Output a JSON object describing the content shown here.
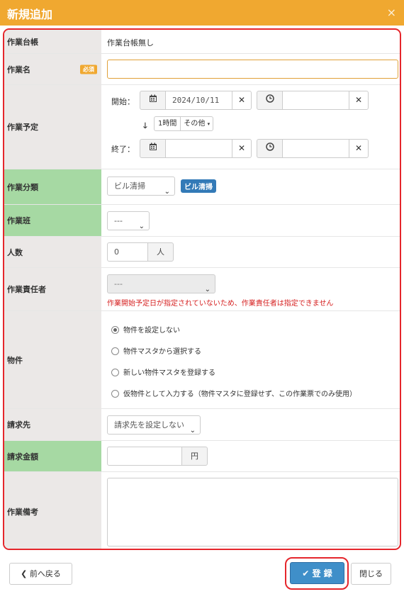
{
  "header": {
    "title": "新規追加",
    "close": "×"
  },
  "fields": {
    "ledger": {
      "label": "作業台帳",
      "value": "作業台帳無し"
    },
    "name": {
      "label": "作業名",
      "required": "必須",
      "value": ""
    },
    "schedule": {
      "label": "作業予定",
      "start_label": "開始：",
      "start_date": "2024/10/11",
      "start_time": "",
      "duration": "1時間",
      "other": "その他",
      "end_label": "終了：",
      "end_date": "",
      "end_time": ""
    },
    "category": {
      "label": "作業分類",
      "selected": "ビル清掃",
      "badge": "ビル清掃"
    },
    "team": {
      "label": "作業班",
      "selected": "---"
    },
    "people": {
      "label": "人数",
      "value": "0",
      "unit": "人"
    },
    "manager": {
      "label": "作業責任者",
      "selected": "---",
      "error": "作業開始予定日が指定されていないため、作業責任者は指定できません"
    },
    "property": {
      "label": "物件",
      "options": [
        {
          "label": "物件を設定しない",
          "checked": true
        },
        {
          "label": "物件マスタから選択する",
          "checked": false
        },
        {
          "label": "新しい物件マスタを登録する",
          "checked": false
        },
        {
          "label": "仮物件として入力する（物件マスタに登録せず、この作業票でのみ使用）",
          "checked": false
        }
      ]
    },
    "billing": {
      "label": "請求先",
      "selected": "請求先を設定しない"
    },
    "amount": {
      "label": "請求金額",
      "value": "",
      "unit": "円"
    },
    "notes": {
      "label": "作業備考",
      "value": ""
    }
  },
  "footer": {
    "back": "前へ戻る",
    "submit": "登 録",
    "close": "閉じる"
  },
  "colors": {
    "header": "#f0a830",
    "highlight": "#e5262c",
    "primary": "#3f8fc9",
    "green_label": "#a6d9a3"
  },
  "icons": [
    "calendar-icon",
    "clock-icon",
    "clear-icon",
    "arrow-down-icon",
    "caret-down-icon",
    "check-icon",
    "chevron-left-icon",
    "close-icon"
  ]
}
